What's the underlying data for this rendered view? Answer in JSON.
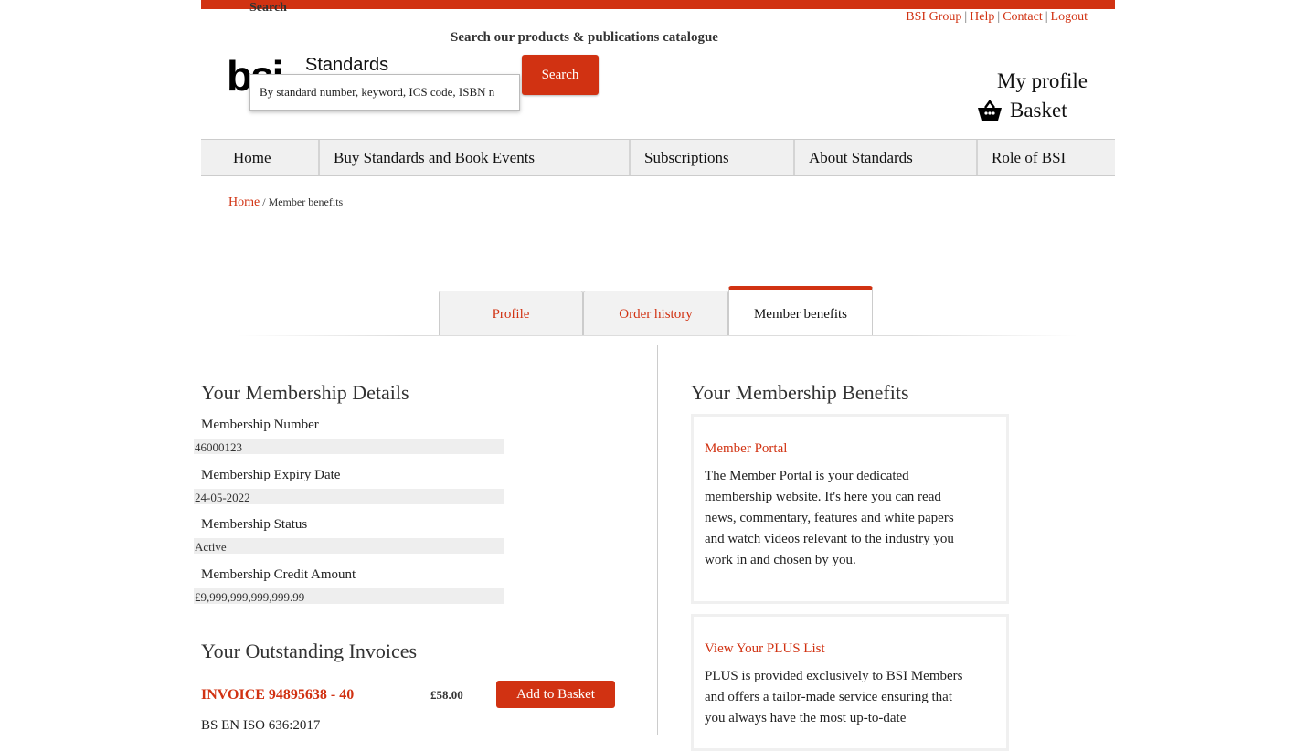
{
  "header": {
    "search_label": "Search",
    "catalogue_title": "Search our products & publications catalogue",
    "search_placeholder": "By standard number, keyword, ICS code, ISBN n",
    "search_button": "Search",
    "logo_text": "bsi",
    "logo_subtext": "Standards",
    "top_links": [
      "BSI Group",
      "Help",
      "Contact",
      "Logout"
    ],
    "my_profile": "My profile",
    "basket": "Basket",
    "accent_color": "#d13212"
  },
  "nav": {
    "items": [
      "Home",
      "Buy Standards and Book Events",
      "Subscriptions",
      "About Standards",
      "Role of BSI"
    ]
  },
  "breadcrumb": {
    "home": "Home",
    "current": "Member benefits"
  },
  "tabs": {
    "items": [
      "Profile",
      "Order history",
      "Member benefits"
    ],
    "active": "Member benefits"
  },
  "membership": {
    "heading": "Your Membership Details",
    "number_label": "Membership Number",
    "number_value": "46000123",
    "expiry_label": "Membership Expiry Date",
    "expiry_value": "24-05-2022",
    "status_label": "Membership Status",
    "status_value": "Active",
    "credit_label": "Membership Credit Amount",
    "credit_value": "£9,999,999,999,999.99"
  },
  "invoices": {
    "heading": "Your Outstanding Invoices",
    "items": [
      {
        "title": "INVOICE 94895638 - 40",
        "price": "£58.00",
        "button": "Add to Basket",
        "standard": "BS EN ISO 636:2017"
      }
    ]
  },
  "benefits": {
    "heading": "Your Membership Benefits",
    "cards": [
      {
        "title": "Member Portal",
        "lines": [
          "The Member Portal is your dedicated",
          "membership website. It's here you can read",
          "news, commentary, features and white papers",
          "and watch videos relevant to the industry you",
          "work in and chosen by you."
        ]
      },
      {
        "title": "View Your PLUS List",
        "lines": [
          "PLUS is provided exclusively to BSI Members",
          "and offers a tailor-made service ensuring that",
          "you always have the most up-to-date"
        ]
      }
    ]
  }
}
